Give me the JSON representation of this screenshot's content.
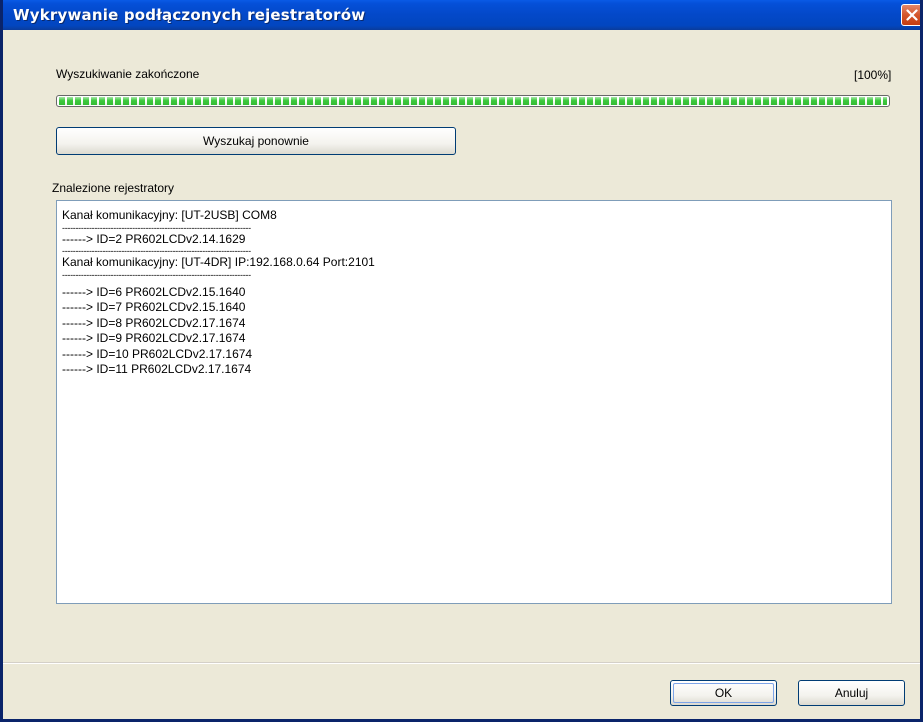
{
  "window": {
    "title": "Wykrywanie podłączonych rejestratorów"
  },
  "status": {
    "label": "Wyszukiwanie zakończone",
    "percent_text": "[100%]",
    "progress_fraction": 1.0,
    "progress_color": "#3cc83c"
  },
  "search_button": {
    "label": "Wyszukaj ponownie"
  },
  "found": {
    "label": "Znalezione rejestratory",
    "lines": [
      {
        "type": "text",
        "text": "Kanał komunikacyjny: [UT-2USB] COM8"
      },
      {
        "type": "sep",
        "text": "----------------------------------------------------------------------"
      },
      {
        "type": "text",
        "text": "------> ID=2 PR602LCDv2.14.1629"
      },
      {
        "type": "sep",
        "text": "----------------------------------------------------------------------"
      },
      {
        "type": "text",
        "text": "Kanał komunikacyjny: [UT-4DR] IP:192.168.0.64  Port:2101"
      },
      {
        "type": "sep",
        "text": "----------------------------------------------------------------------"
      },
      {
        "type": "space",
        "text": ""
      },
      {
        "type": "text",
        "text": "------> ID=6 PR602LCDv2.15.1640"
      },
      {
        "type": "text",
        "text": "------> ID=7 PR602LCDv2.15.1640"
      },
      {
        "type": "text",
        "text": "------> ID=8 PR602LCDv2.17.1674"
      },
      {
        "type": "text",
        "text": "------> ID=9 PR602LCDv2.17.1674"
      },
      {
        "type": "text",
        "text": "------> ID=10 PR602LCDv2.17.1674"
      },
      {
        "type": "text",
        "text": "------> ID=11 PR602LCDv2.17.1674"
      }
    ]
  },
  "buttons": {
    "ok_label": "OK",
    "cancel_label": "Anuluj"
  },
  "icons": {
    "close": "close-icon"
  },
  "colors": {
    "titlebar": "#0348c8",
    "close_button": "#d4562a",
    "dialog_background": "#ece9d8"
  }
}
